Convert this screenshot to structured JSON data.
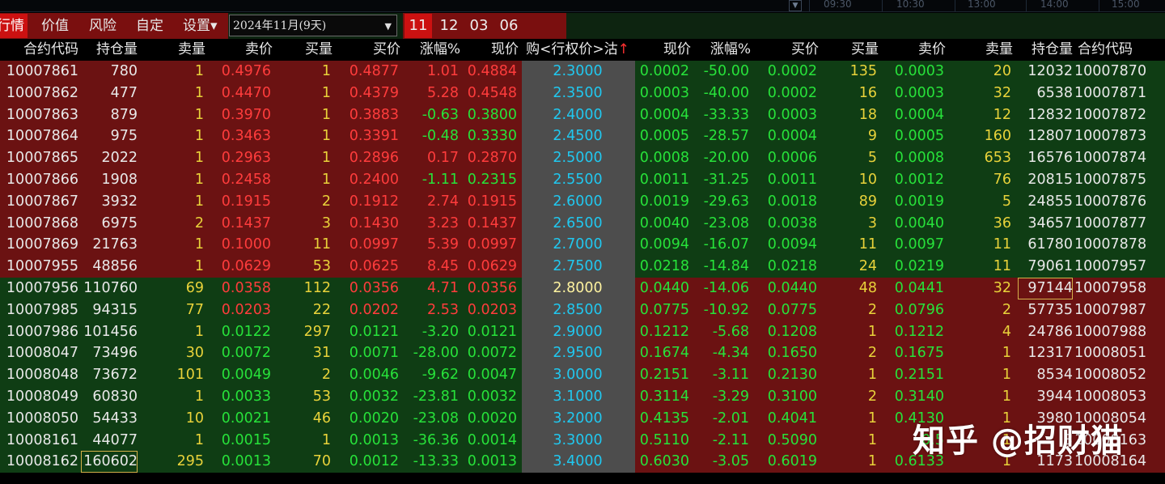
{
  "timeline": {
    "times": [
      "09:30",
      "10:30",
      "13:00",
      "14:00",
      "15:00"
    ],
    "box_icon": "▼"
  },
  "toolbar": {
    "tabs": [
      {
        "label": "行情",
        "active": true
      },
      {
        "label": "价值",
        "active": false
      },
      {
        "label": "风险",
        "active": false
      },
      {
        "label": "自定",
        "active": false
      },
      {
        "label": "设置▾",
        "active": false
      }
    ],
    "expiry_select": {
      "value": "2024年11月(9天)",
      "arrow": "▼"
    },
    "months": [
      {
        "label": "11",
        "active": true
      },
      {
        "label": "12",
        "active": false
      },
      {
        "label": "03",
        "active": false
      },
      {
        "label": "06",
        "active": false
      }
    ]
  },
  "headers": {
    "call": [
      "合约代码",
      "持仓量",
      "卖量",
      "卖价",
      "买量",
      "买价",
      "涨幅%",
      "现价"
    ],
    "strike": "购<行权价>沽",
    "strike_arrow": "↑",
    "put": [
      "现价",
      "涨幅%",
      "买价",
      "买量",
      "卖价",
      "卖量",
      "持仓量",
      "合约代码"
    ]
  },
  "colors": {
    "up_bg": "#6b1212",
    "down_bg": "#0f3d14",
    "strike_bg": "#4d4d4d",
    "red": "#ff3c3c",
    "green": "#27e23a",
    "yellow": "#e8d23a",
    "white": "#e8e8e8",
    "cyan": "#20c8f0"
  },
  "rows": [
    {
      "strike": "2.3000",
      "call_itm": true,
      "call": {
        "code": "10007861",
        "oi": "780",
        "ask_vol": "1",
        "ask": "0.4976",
        "bid_vol": "1",
        "bid": "0.4877",
        "chg": "1.01",
        "last": "0.4884"
      },
      "put": {
        "last": "0.0002",
        "chg": "-50.00",
        "bid": "0.0002",
        "bid_vol": "135",
        "ask": "0.0003",
        "ask_vol": "20",
        "oi": "12032",
        "code": "10007870"
      }
    },
    {
      "strike": "2.3500",
      "call_itm": true,
      "call": {
        "code": "10007862",
        "oi": "477",
        "ask_vol": "1",
        "ask": "0.4470",
        "bid_vol": "1",
        "bid": "0.4379",
        "chg": "5.28",
        "last": "0.4548"
      },
      "put": {
        "last": "0.0003",
        "chg": "-40.00",
        "bid": "0.0002",
        "bid_vol": "16",
        "ask": "0.0003",
        "ask_vol": "32",
        "oi": "6538",
        "code": "10007871"
      }
    },
    {
      "strike": "2.4000",
      "call_itm": true,
      "call": {
        "code": "10007863",
        "oi": "879",
        "ask_vol": "1",
        "ask": "0.3970",
        "bid_vol": "1",
        "bid": "0.3883",
        "chg": "-0.63",
        "last": "0.3800"
      },
      "put": {
        "last": "0.0004",
        "chg": "-33.33",
        "bid": "0.0003",
        "bid_vol": "18",
        "ask": "0.0004",
        "ask_vol": "12",
        "oi": "12832",
        "code": "10007872"
      }
    },
    {
      "strike": "2.4500",
      "call_itm": true,
      "call": {
        "code": "10007864",
        "oi": "975",
        "ask_vol": "1",
        "ask": "0.3463",
        "bid_vol": "1",
        "bid": "0.3391",
        "chg": "-0.48",
        "last": "0.3330"
      },
      "put": {
        "last": "0.0005",
        "chg": "-28.57",
        "bid": "0.0004",
        "bid_vol": "9",
        "ask": "0.0005",
        "ask_vol": "160",
        "oi": "12807",
        "code": "10007873"
      }
    },
    {
      "strike": "2.5000",
      "call_itm": true,
      "call": {
        "code": "10007865",
        "oi": "2022",
        "ask_vol": "1",
        "ask": "0.2963",
        "bid_vol": "1",
        "bid": "0.2896",
        "chg": "0.17",
        "last": "0.2870"
      },
      "put": {
        "last": "0.0008",
        "chg": "-20.00",
        "bid": "0.0006",
        "bid_vol": "5",
        "ask": "0.0008",
        "ask_vol": "653",
        "oi": "16576",
        "code": "10007874"
      }
    },
    {
      "strike": "2.5500",
      "call_itm": true,
      "call": {
        "code": "10007866",
        "oi": "1908",
        "ask_vol": "1",
        "ask": "0.2458",
        "bid_vol": "1",
        "bid": "0.2400",
        "chg": "-1.11",
        "last": "0.2315"
      },
      "put": {
        "last": "0.0011",
        "chg": "-31.25",
        "bid": "0.0011",
        "bid_vol": "10",
        "ask": "0.0012",
        "ask_vol": "76",
        "oi": "20815",
        "code": "10007875"
      }
    },
    {
      "strike": "2.6000",
      "call_itm": true,
      "call": {
        "code": "10007867",
        "oi": "3932",
        "ask_vol": "1",
        "ask": "0.1915",
        "bid_vol": "2",
        "bid": "0.1912",
        "chg": "2.74",
        "last": "0.1915"
      },
      "put": {
        "last": "0.0019",
        "chg": "-29.63",
        "bid": "0.0018",
        "bid_vol": "89",
        "ask": "0.0019",
        "ask_vol": "5",
        "oi": "24855",
        "code": "10007876"
      }
    },
    {
      "strike": "2.6500",
      "call_itm": true,
      "call": {
        "code": "10007868",
        "oi": "6975",
        "ask_vol": "2",
        "ask": "0.1437",
        "bid_vol": "3",
        "bid": "0.1430",
        "chg": "3.23",
        "last": "0.1437"
      },
      "put": {
        "last": "0.0040",
        "chg": "-23.08",
        "bid": "0.0038",
        "bid_vol": "3",
        "ask": "0.0040",
        "ask_vol": "36",
        "oi": "34657",
        "code": "10007877"
      }
    },
    {
      "strike": "2.7000",
      "call_itm": true,
      "call": {
        "code": "10007869",
        "oi": "21763",
        "ask_vol": "1",
        "ask": "0.1000",
        "bid_vol": "11",
        "bid": "0.0997",
        "chg": "5.39",
        "last": "0.0997"
      },
      "put": {
        "last": "0.0094",
        "chg": "-16.07",
        "bid": "0.0094",
        "bid_vol": "11",
        "ask": "0.0097",
        "ask_vol": "11",
        "oi": "61780",
        "code": "10007878"
      }
    },
    {
      "strike": "2.7500",
      "call_itm": true,
      "call": {
        "code": "10007955",
        "oi": "48856",
        "ask_vol": "1",
        "ask": "0.0629",
        "bid_vol": "53",
        "bid": "0.0625",
        "chg": "8.45",
        "last": "0.0629"
      },
      "put": {
        "last": "0.0218",
        "chg": "-14.84",
        "bid": "0.0218",
        "bid_vol": "24",
        "ask": "0.0219",
        "ask_vol": "11",
        "oi": "79061",
        "code": "10007957"
      }
    },
    {
      "strike": "2.8000",
      "call_itm": false,
      "strike_highlight": true,
      "call": {
        "code": "10007956",
        "oi": "110760",
        "ask_vol": "69",
        "ask": "0.0358",
        "bid_vol": "112",
        "bid": "0.0356",
        "chg": "4.71",
        "last": "0.0356"
      },
      "put": {
        "last": "0.0440",
        "chg": "-14.06",
        "bid": "0.0440",
        "bid_vol": "48",
        "ask": "0.0441",
        "ask_vol": "32",
        "oi": "97144",
        "oi_boxed": true,
        "code": "10007958"
      }
    },
    {
      "strike": "2.8500",
      "call_itm": false,
      "call": {
        "code": "10007985",
        "oi": "94315",
        "ask_vol": "77",
        "ask": "0.0203",
        "bid_vol": "22",
        "bid": "0.0202",
        "chg": "2.53",
        "last": "0.0203"
      },
      "put": {
        "last": "0.0775",
        "chg": "-10.92",
        "bid": "0.0775",
        "bid_vol": "2",
        "ask": "0.0796",
        "ask_vol": "2",
        "oi": "57735",
        "code": "10007987"
      }
    },
    {
      "strike": "2.9000",
      "call_itm": false,
      "call": {
        "code": "10007986",
        "oi": "101456",
        "ask_vol": "1",
        "ask": "0.0122",
        "bid_vol": "297",
        "bid": "0.0121",
        "chg": "-3.20",
        "last": "0.0121"
      },
      "put": {
        "last": "0.1212",
        "chg": "-5.68",
        "bid": "0.1208",
        "bid_vol": "1",
        "ask": "0.1212",
        "ask_vol": "4",
        "oi": "24786",
        "code": "10007988"
      }
    },
    {
      "strike": "2.9500",
      "call_itm": false,
      "call": {
        "code": "10008047",
        "oi": "73496",
        "ask_vol": "30",
        "ask": "0.0072",
        "bid_vol": "31",
        "bid": "0.0071",
        "chg": "-28.00",
        "last": "0.0072"
      },
      "put": {
        "last": "0.1674",
        "chg": "-4.34",
        "bid": "0.1650",
        "bid_vol": "2",
        "ask": "0.1675",
        "ask_vol": "1",
        "oi": "12317",
        "code": "10008051"
      }
    },
    {
      "strike": "3.0000",
      "call_itm": false,
      "call": {
        "code": "10008048",
        "oi": "73672",
        "ask_vol": "101",
        "ask": "0.0049",
        "bid_vol": "2",
        "bid": "0.0046",
        "chg": "-9.62",
        "last": "0.0047"
      },
      "put": {
        "last": "0.2151",
        "chg": "-3.11",
        "bid": "0.2130",
        "bid_vol": "1",
        "ask": "0.2151",
        "ask_vol": "1",
        "oi": "8534",
        "code": "10008052"
      }
    },
    {
      "strike": "3.1000",
      "call_itm": false,
      "call": {
        "code": "10008049",
        "oi": "60830",
        "ask_vol": "1",
        "ask": "0.0033",
        "bid_vol": "53",
        "bid": "0.0032",
        "chg": "-23.81",
        "last": "0.0032"
      },
      "put": {
        "last": "0.3114",
        "chg": "-3.29",
        "bid": "0.3100",
        "bid_vol": "2",
        "ask": "0.3140",
        "ask_vol": "1",
        "oi": "3944",
        "code": "10008053"
      }
    },
    {
      "strike": "3.2000",
      "call_itm": false,
      "call": {
        "code": "10008050",
        "oi": "54433",
        "ask_vol": "10",
        "ask": "0.0021",
        "bid_vol": "46",
        "bid": "0.0020",
        "chg": "-23.08",
        "last": "0.0020"
      },
      "put": {
        "last": "0.4135",
        "chg": "-2.01",
        "bid": "0.4041",
        "bid_vol": "1",
        "ask": "0.4130",
        "ask_vol": "1",
        "oi": "3980",
        "code": "10008054"
      }
    },
    {
      "strike": "3.3000",
      "call_itm": false,
      "call": {
        "code": "10008161",
        "oi": "44077",
        "ask_vol": "1",
        "ask": "0.0015",
        "bid_vol": "1",
        "bid": "0.0013",
        "chg": "-36.36",
        "last": "0.0014"
      },
      "put": {
        "last": "0.5110",
        "chg": "-2.11",
        "bid": "0.5090",
        "bid_vol": "1",
        "ask": "0.5",
        "ask_vol": "1",
        "oi": "3",
        "code": "10008163"
      }
    },
    {
      "strike": "3.4000",
      "call_itm": false,
      "call": {
        "code": "10008162",
        "oi": "160602",
        "oi_boxed": true,
        "ask_vol": "295",
        "ask": "0.0013",
        "bid_vol": "70",
        "bid": "0.0012",
        "chg": "-13.33",
        "last": "0.0013"
      },
      "put": {
        "last": "0.6030",
        "chg": "-3.05",
        "bid": "0.6019",
        "bid_vol": "1",
        "ask": "0.6133",
        "ask_vol": "1",
        "oi": "1173",
        "code": "10008164"
      }
    }
  ],
  "watermark": "知乎 @招财猫"
}
